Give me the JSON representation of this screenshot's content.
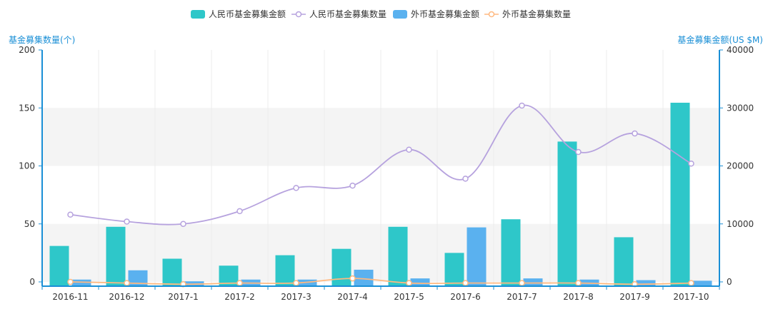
{
  "colors": {
    "rmb_amount": "#2ec7c9",
    "rmb_count": "#b6a2de",
    "fx_amount": "#5ab1ef",
    "fx_count": "#ffb980",
    "axis": "#1a8fd6",
    "band": "#f4f4f4"
  },
  "chart_data": {
    "type": "bar",
    "categories": [
      "2016-11",
      "2016-12",
      "2017-1",
      "2017-2",
      "2017-3",
      "2017-4",
      "2017-5",
      "2017-6",
      "2017-7",
      "2017-8",
      "2017-9",
      "2017-10"
    ],
    "legend": {
      "position": "top-center",
      "items": [
        {
          "name": "人民币基金募集金额",
          "kind": "bar"
        },
        {
          "name": "人民币基金募集数量",
          "kind": "line"
        },
        {
          "name": "外币基金募集金额",
          "kind": "bar"
        },
        {
          "name": "外币基金募集数量",
          "kind": "line"
        }
      ]
    },
    "left_axis": {
      "label": "基金募集数量(个)",
      "min": 0,
      "max": 200,
      "ticks": [
        0,
        50,
        100,
        150,
        200
      ]
    },
    "right_axis": {
      "label": "基金募集金额(US $M)",
      "min": 0,
      "max": 40000,
      "ticks": [
        0,
        10000,
        20000,
        30000,
        40000
      ]
    },
    "series": [
      {
        "name": "人民币基金募集金额",
        "type": "bar",
        "axis": "right",
        "values": [
          6200,
          9500,
          4000,
          2800,
          4600,
          5700,
          9500,
          5000,
          10800,
          24200,
          7700,
          30900
        ]
      },
      {
        "name": "外币基金募集金额",
        "type": "bar",
        "axis": "right",
        "values": [
          400,
          2000,
          100,
          400,
          400,
          2100,
          600,
          9400,
          600,
          400,
          300,
          200
        ]
      },
      {
        "name": "人民币基金募集数量",
        "type": "line",
        "axis": "left",
        "values": [
          58,
          52,
          50,
          61,
          81,
          83,
          114,
          89,
          152,
          112,
          128,
          102
        ]
      },
      {
        "name": "外币基金募集数量",
        "type": "line",
        "axis": "left",
        "values": [
          0,
          -1,
          -2,
          -1,
          -1,
          3,
          -1,
          -1,
          -1,
          -1,
          -2,
          -1
        ]
      }
    ],
    "grid": "alternating-bands"
  }
}
